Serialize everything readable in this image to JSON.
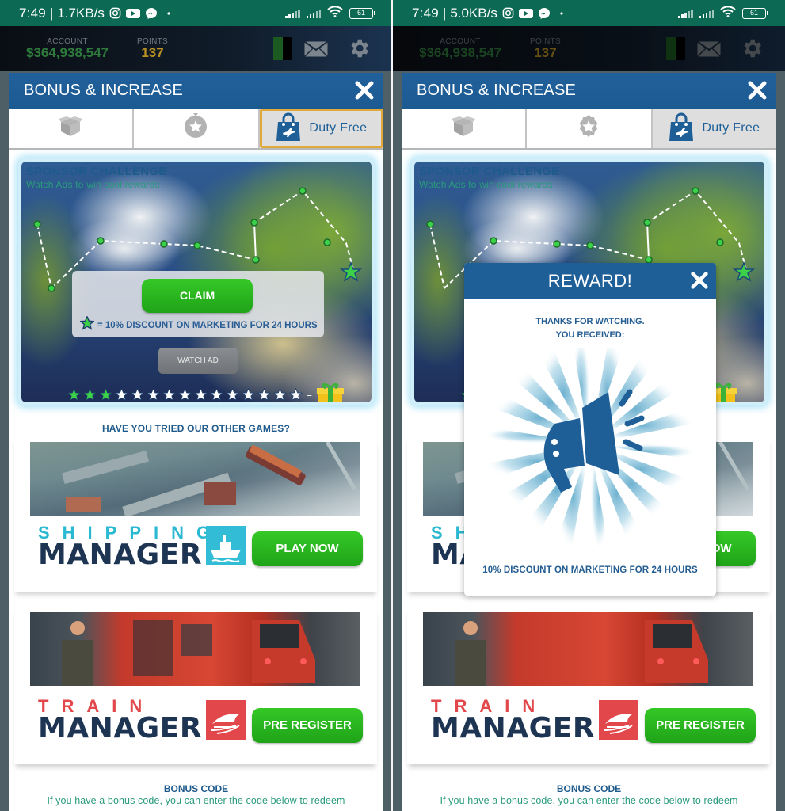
{
  "screens": [
    {
      "status_bar": {
        "time": "7:49",
        "separator": "|",
        "net_speed": "1.7KB/s",
        "battery": "61"
      },
      "game_header": {
        "account_label": "ACCOUNT",
        "account_value": "$364,938,547",
        "points_label": "POINTS",
        "points_value": "137"
      }
    },
    {
      "status_bar": {
        "time": "7:49",
        "separator": "|",
        "net_speed": "5.0KB/s",
        "battery": "61"
      },
      "game_header": {
        "account_label": "ACCOUNT",
        "account_value": "$364,938,547",
        "points_label": "POINTS",
        "points_value": "137"
      }
    }
  ],
  "status_icons": [
    "instagram-icon",
    "youtube-icon",
    "messenger-icon",
    "dot-icon",
    "signal-icon",
    "signal-icon",
    "wifi-icon",
    "battery-icon"
  ],
  "modal": {
    "title": "BONUS & INCREASE",
    "tabs": [
      {
        "icon": "gift-box-icon",
        "label": ""
      },
      {
        "icon": "star-badge-icon",
        "label": ""
      },
      {
        "icon": "duty-free-bag-icon",
        "label": "Duty Free",
        "active": true
      }
    ],
    "sponsor": {
      "title": "SPONSOR CHALLENGE",
      "subtitle": "Watch Ads to win cool rewards",
      "claim_label": "CLAIM",
      "reward_line": "= 10% DISCOUNT ON MARKETING FOR 24 HOURS",
      "watch_ad_label": "WATCH AD",
      "stars_total": 15,
      "stars_earned": 3,
      "stars_equals": "="
    },
    "other_games_title": "HAVE YOU TRIED OUR OTHER GAMES?",
    "games": [
      {
        "logo_top": "SHIPPING",
        "logo_bottom": "MANAGER",
        "button": "PLAY NOW"
      },
      {
        "logo_top": "TRAIN",
        "logo_bottom": "MANAGER",
        "button": "PRE REGISTER"
      }
    ],
    "bonus_code": {
      "title": "BONUS CODE",
      "text": "If you have a bonus code, you can enter the code below to redeem"
    }
  },
  "reward_popup": {
    "title": "REWARD!",
    "message_line1": "THANKS FOR WATCHING.",
    "message_line2": "YOU RECEIVED:",
    "icon": "megaphone-icon",
    "description": "10% DISCOUNT ON MARKETING FOR 24 HOURS"
  },
  "colors": {
    "status_bar": "#0c6953",
    "modal_header": "#1f5f98",
    "tab_active_outline": "#e2a93a",
    "green_button": "#2bb520",
    "title_blue": "#1f5a8c",
    "subtitle_teal": "#2a9a7c",
    "shipping_accent": "#32bcd5",
    "train_accent": "#e2474b"
  }
}
